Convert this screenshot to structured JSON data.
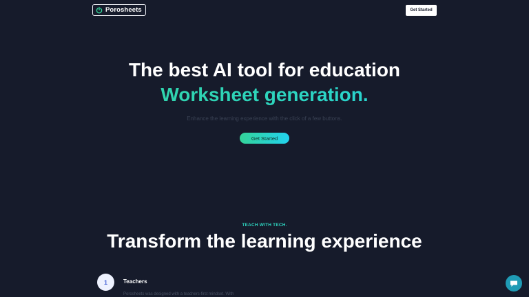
{
  "header": {
    "logo_text": "Porosheets",
    "logo_icon": "power-icon",
    "cta_label": "Get Started"
  },
  "hero": {
    "title": "The best AI tool for education",
    "subtitle": "Worksheet generation.",
    "tagline": "Enhance the learning experience with the click of a few buttons.",
    "cta_label": "Get Started",
    "gradient_colors": [
      "#34d399",
      "#22d3ee"
    ]
  },
  "section": {
    "eyebrow": "TEACH WITH TECH.",
    "title": "Transform the learning experience",
    "steps": [
      {
        "number": "1",
        "title": "Teachers",
        "description": "Porosheets was designed with a teachers-first mindset. With"
      }
    ]
  },
  "chat": {
    "icon": "chat-bubble-icon"
  },
  "colors": {
    "background": "#161b2b",
    "accent": "#2dd4bf"
  }
}
